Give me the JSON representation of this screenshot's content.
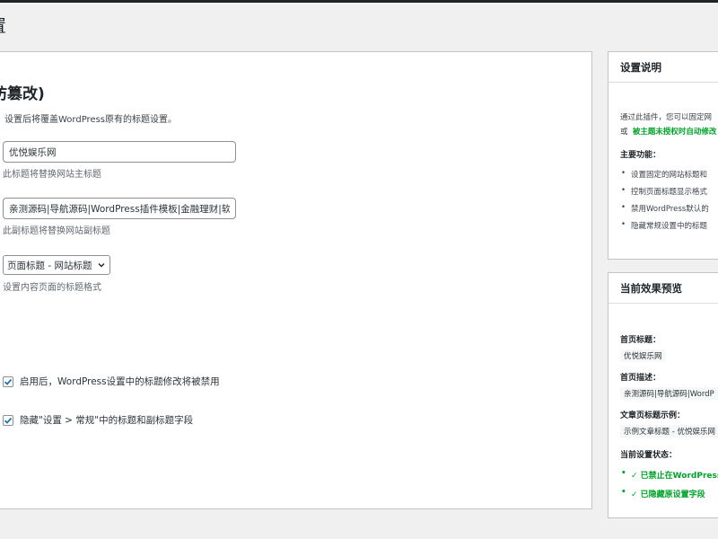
{
  "page": {
    "title": "置"
  },
  "main": {
    "section_title": "防篡改)",
    "intro": "设置后将覆盖WordPress原有的标题设置。",
    "site_title_value": "优悦娱乐网",
    "site_title_desc": "此标题将替换网站主标题",
    "subtitle_value": "亲测源码|导航源码|WordPress插件模板|金融理财|软件",
    "subtitle_desc": "此副标题将替换网站副标题",
    "format_select": "页面标题 - 网站标题",
    "format_desc": "设置内容页面的标题格式",
    "checkbox_disable_label": "启用后，WordPress设置中的标题修改将被禁用",
    "checkbox_hide_label": "隐藏\"设置 > 常规\"中的标题和副标题字段"
  },
  "help_panel": {
    "title": "设置说明",
    "desc_line1": "通过此插件，您可以固定网",
    "desc_line2_prefix": "或",
    "desc_line2_bold": "被主题未授权时自动修改",
    "features_title": "主要功能：",
    "features": [
      "设置固定的网站标题和",
      "控制页面标题显示格式",
      "禁用WordPress默认的",
      "隐藏常规设置中的标题"
    ]
  },
  "preview_panel": {
    "title": "当前效果预览",
    "home_title_label": "首页标题：",
    "home_title_value": "优悦娱乐网",
    "home_desc_label": "首页描述：",
    "home_desc_value": "亲测源码|导航源码|WordP",
    "post_title_label": "文章页标题示例：",
    "post_title_value": "示例文章标题 - 优悦娱乐网",
    "status_label": "当前设置状态：",
    "status_items": [
      "✓ 已禁止在WordPress",
      "✓ 已隐藏原设置字段"
    ]
  },
  "colors": {
    "admin_bar": "#1d2327",
    "background": "#f0f0f1",
    "checkbox_accent": "#2271b1",
    "status_green": "#00a32a"
  }
}
